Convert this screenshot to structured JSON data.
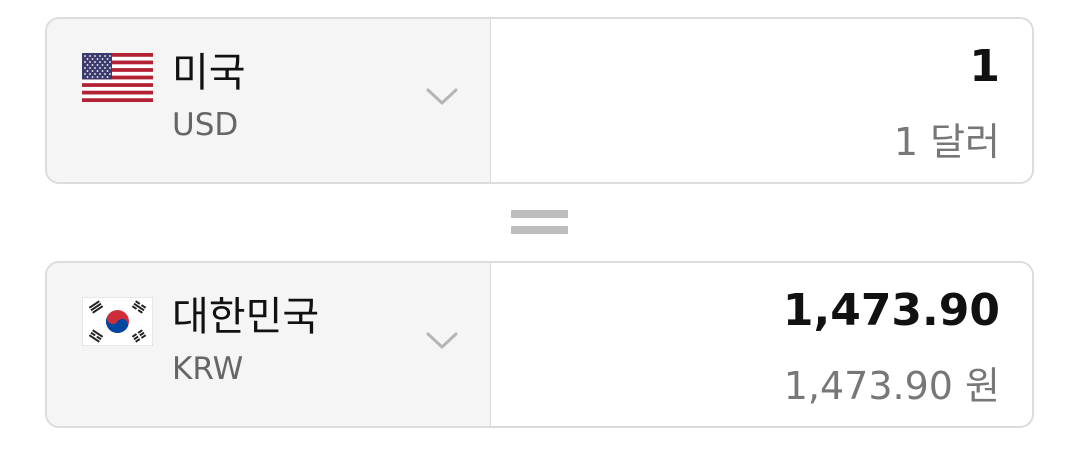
{
  "from": {
    "country": "미국",
    "code": "USD",
    "flag_icon": "us-flag-icon",
    "amount": "1",
    "amount_text": "1 달러"
  },
  "operator_icon": "equals-icon",
  "to": {
    "country": "대한민국",
    "code": "KRW",
    "flag_icon": "kr-flag-icon",
    "amount": "1,473.90",
    "amount_text": "1,473.90 원"
  },
  "colors": {
    "panel_border": "#dcdcdc",
    "selector_bg": "#f5f5f5",
    "primary_text": "#111111",
    "secondary_text": "#777777",
    "equals": "#bdbdbd",
    "us_red": "#b22234",
    "us_blue": "#3c3b6e",
    "kr_red": "#cd2e3a",
    "kr_blue": "#0047a0"
  }
}
